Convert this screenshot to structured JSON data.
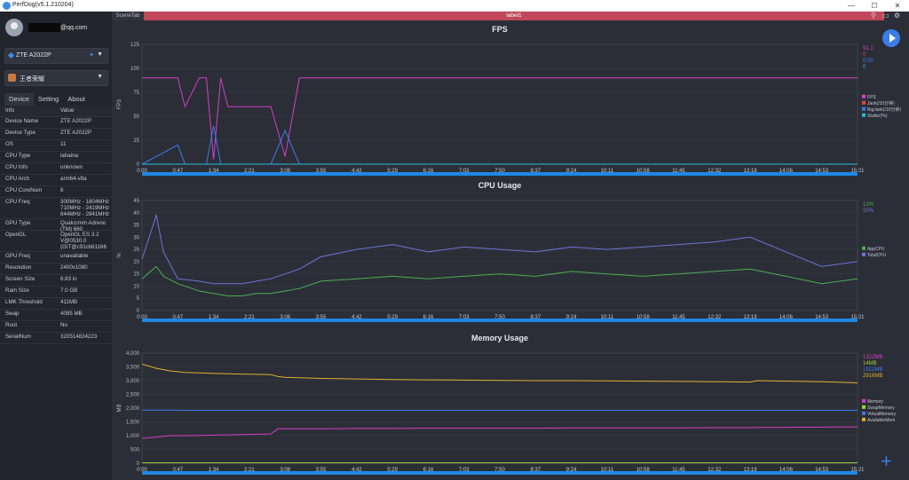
{
  "window": {
    "title": "PerfDog(v5.1.210204)",
    "min": "—",
    "max": "☐",
    "close": "✕"
  },
  "user": {
    "email_suffix": "@qq.com"
  },
  "device_select": {
    "label": "ZTE A2022P"
  },
  "app_select": {
    "label": "王者荣耀"
  },
  "tabs": [
    {
      "label": "Device"
    },
    {
      "label": "Setting"
    },
    {
      "label": "About"
    }
  ],
  "info_header": {
    "key": "Info",
    "value": "Value"
  },
  "info": [
    {
      "key": "Device Name",
      "value": "ZTE A2022P"
    },
    {
      "key": "Device Type",
      "value": "ZTE A2022P"
    },
    {
      "key": "OS",
      "value": "11"
    },
    {
      "key": "CPU Type",
      "value": "lahaina"
    },
    {
      "key": "CPU Info",
      "value": "unknown"
    },
    {
      "key": "CPU Arch",
      "value": "arm64-v8a"
    },
    {
      "key": "CPU CoreNum",
      "value": "8"
    },
    {
      "key": "CPU Freq",
      "value": "300MHz - 1804MHz\n710MHz - 2419MHz\n844MHz - 2841MHz"
    },
    {
      "key": "GPU Type",
      "value": "Qualcomm Adreno\n(TM) 660"
    },
    {
      "key": "OpenGL",
      "value": "OpenGL ES 3.2\nV@0530.0\n(GIT@c91cb61166"
    },
    {
      "key": "GPU Freq",
      "value": "unavailable"
    },
    {
      "key": "Resolution",
      "value": "2400x1080"
    },
    {
      "key": "Screen Size",
      "value": "6.83 in"
    },
    {
      "key": "Ram Size",
      "value": "7.0 GB"
    },
    {
      "key": "LMK Threshold",
      "value": "411MB"
    },
    {
      "key": "Swap",
      "value": "4095 MB"
    },
    {
      "key": "Root",
      "value": "No"
    },
    {
      "key": "SerialNum",
      "value": "320514824223"
    }
  ],
  "scene_tab": "SceneTab",
  "label_bar": "label1",
  "icons": {
    "location": "location-pin-icon",
    "folder": "folder-icon",
    "settings": "gear-icon",
    "play": "play-icon",
    "add": "plus-icon"
  },
  "colors": {
    "accent": "#3a7de6",
    "label_bar": "#c0485a",
    "fps": "#d33fc4",
    "jank": "#e0453a",
    "bigjank": "#3a7de6",
    "stutter": "#2ab9d8",
    "app_cpu": "#4caf50",
    "total_cpu": "#6f74d6",
    "memory": "#d33fc4",
    "swap": "#9dd23a",
    "virtual": "#3a7de6",
    "available": "#e0b030"
  },
  "time_labels": [
    "0:00",
    "0:47",
    "1:34",
    "2:21",
    "3:08",
    "3:55",
    "4:42",
    "5:29",
    "6:16",
    "7:03",
    "7:50",
    "8:37",
    "9:24",
    "10:11",
    "10:58",
    "11:45",
    "12:32",
    "13:19",
    "14:06",
    "14:53",
    "15:21"
  ],
  "chart_data": [
    {
      "type": "line",
      "title": "FPS",
      "ylabel": "FPS",
      "ylim": [
        0,
        125
      ],
      "yticks": [
        "125",
        "100",
        "75",
        "50",
        "25",
        "0"
      ],
      "x": [
        0,
        5,
        6,
        8,
        9,
        10,
        11,
        12,
        13,
        14,
        16,
        17,
        18,
        20,
        22,
        25,
        30,
        35,
        40,
        45,
        50,
        55,
        60,
        65,
        70,
        75,
        80,
        85,
        90,
        95,
        100
      ],
      "series": [
        {
          "name": "FPS",
          "values": [
            90,
            90,
            60,
            90,
            90,
            5,
            90,
            60,
            60,
            60,
            60,
            60,
            60,
            8,
            90,
            90,
            90,
            90,
            90,
            90,
            90,
            90,
            90,
            90,
            90,
            90,
            90,
            90,
            90,
            90,
            90
          ]
        },
        {
          "name": "Jank(/10分钟)",
          "values": [
            0,
            0,
            0,
            0,
            0,
            0,
            0,
            0,
            0,
            0,
            0,
            0,
            0,
            0,
            0,
            0,
            0,
            0,
            0,
            0,
            0,
            0,
            0,
            0,
            0,
            0,
            0,
            0,
            0,
            0,
            0
          ]
        },
        {
          "name": "BigJank(/10分钟)",
          "values": [
            0,
            20,
            0,
            0,
            0,
            40,
            0,
            0,
            0,
            0,
            0,
            0,
            0,
            35,
            0,
            0,
            0,
            0,
            0,
            0,
            0,
            0,
            0,
            0,
            0,
            0,
            0,
            0,
            0,
            0,
            0
          ]
        },
        {
          "name": "Stutter(%)",
          "values": [
            0,
            0,
            0,
            0,
            0,
            0,
            0,
            0,
            0,
            0,
            0,
            0,
            0,
            0,
            0,
            0,
            0,
            0,
            0,
            0,
            0,
            0,
            0,
            0,
            0,
            0,
            0,
            0,
            0,
            0,
            0
          ]
        }
      ],
      "current": [
        "91.1",
        "0",
        "0.00",
        "0"
      ]
    },
    {
      "type": "line",
      "title": "CPU Usage",
      "ylabel": "%",
      "ylim": [
        0,
        45
      ],
      "yticks": [
        "45",
        "40",
        "35",
        "30",
        "25",
        "20",
        "15",
        "10",
        "5",
        "0"
      ],
      "x": [
        0,
        2,
        3,
        5,
        8,
        10,
        12,
        14,
        16,
        18,
        20,
        22,
        25,
        30,
        35,
        40,
        45,
        50,
        55,
        60,
        65,
        70,
        75,
        80,
        85,
        90,
        95,
        100
      ],
      "series": [
        {
          "name": "AppCPU",
          "values": [
            13,
            18,
            14,
            11,
            8,
            7,
            6,
            6,
            7,
            7,
            8,
            9,
            12,
            13,
            14,
            13,
            14,
            15,
            14,
            16,
            15,
            14,
            15,
            16,
            17,
            14,
            11,
            13
          ]
        },
        {
          "name": "TotalCPU",
          "values": [
            21,
            39,
            24,
            13,
            12,
            11,
            11,
            11,
            12,
            13,
            15,
            17,
            22,
            25,
            27,
            24,
            26,
            25,
            24,
            26,
            25,
            26,
            27,
            28,
            30,
            24,
            18,
            20
          ]
        }
      ],
      "current": [
        "12%",
        "20%"
      ]
    },
    {
      "type": "line",
      "title": "Memory Usage",
      "ylabel": "MB",
      "ylim": [
        0,
        4000
      ],
      "yticks": [
        "4,000",
        "3,500",
        "3,000",
        "2,500",
        "2,000",
        "1,500",
        "1,000",
        "500",
        "0"
      ],
      "x": [
        0,
        2,
        4,
        6,
        8,
        10,
        12,
        14,
        16,
        18,
        19,
        20,
        25,
        30,
        35,
        40,
        45,
        50,
        55,
        60,
        65,
        70,
        75,
        80,
        85,
        86,
        90,
        95,
        100
      ],
      "series": [
        {
          "name": "Memory",
          "values": [
            900,
            950,
            1000,
            1000,
            1010,
            1020,
            1030,
            1040,
            1050,
            1060,
            1250,
            1250,
            1250,
            1260,
            1260,
            1270,
            1270,
            1270,
            1270,
            1280,
            1280,
            1280,
            1280,
            1290,
            1290,
            1300,
            1300,
            1310,
            1320
          ]
        },
        {
          "name": "SwapMemory",
          "values": [
            14,
            14,
            14,
            14,
            14,
            14,
            14,
            14,
            14,
            14,
            14,
            14,
            14,
            14,
            14,
            14,
            14,
            14,
            14,
            14,
            14,
            14,
            14,
            14,
            14,
            14,
            14,
            14,
            14
          ]
        },
        {
          "name": "VirtualMemory",
          "values": [
            1930,
            1930,
            1930,
            1920,
            1920,
            1920,
            1920,
            1920,
            1920,
            1920,
            1920,
            1920,
            1920,
            1920,
            1920,
            1920,
            1920,
            1920,
            1920,
            1920,
            1920,
            1920,
            1920,
            1920,
            1920,
            1920,
            1920,
            1920,
            1920
          ]
        },
        {
          "name": "AvailableMem",
          "values": [
            3600,
            3450,
            3350,
            3300,
            3280,
            3260,
            3250,
            3240,
            3230,
            3220,
            3150,
            3120,
            3080,
            3060,
            3040,
            3030,
            3020,
            3010,
            3000,
            3000,
            2990,
            2980,
            2970,
            2960,
            2950,
            3000,
            2980,
            2960,
            2920
          ]
        }
      ],
      "current": [
        "1322MB",
        "14MB",
        "1922MB",
        "2916MB"
      ]
    }
  ]
}
